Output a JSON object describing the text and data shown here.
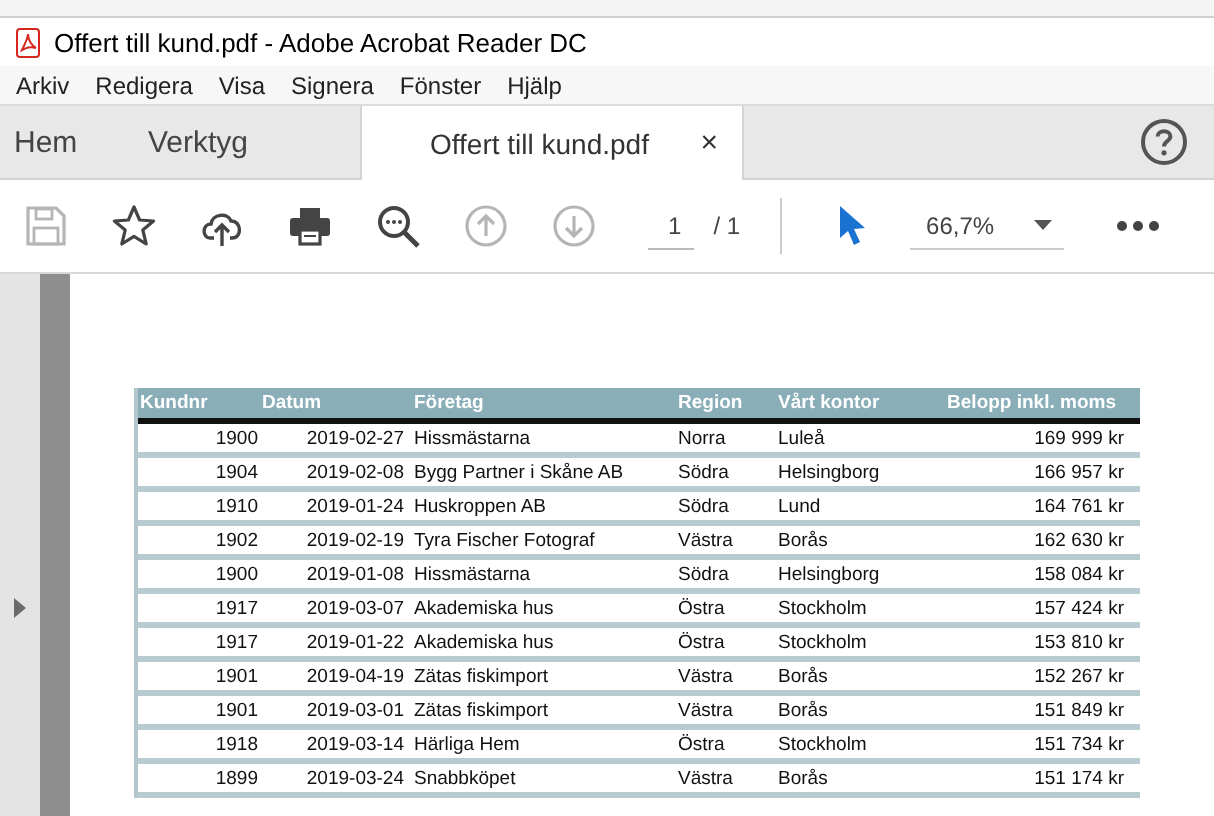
{
  "window": {
    "title": "Offert till kund.pdf - Adobe Acrobat Reader DC"
  },
  "menu": [
    "Arkiv",
    "Redigera",
    "Visa",
    "Signera",
    "Fönster",
    "Hjälp"
  ],
  "tabs": [
    {
      "label": "Hem",
      "selected": false
    },
    {
      "label": "Verktyg",
      "selected": false
    },
    {
      "label": "Offert till kund.pdf",
      "selected": true,
      "close": "×"
    }
  ],
  "toolbar": {
    "tools": [
      {
        "kind": "save",
        "disabled": true
      },
      {
        "kind": "star",
        "disabled": false
      },
      {
        "kind": "upload",
        "disabled": false
      },
      {
        "kind": "print",
        "disabled": false
      },
      {
        "kind": "find",
        "disabled": false
      },
      {
        "kind": "up",
        "disabled": true
      },
      {
        "kind": "down",
        "disabled": true
      }
    ],
    "page": "1",
    "page_total": "/ 1",
    "zoom": "66,7%"
  },
  "table": {
    "columns": [
      "Kundnr",
      "Datum",
      "Företag",
      "Region",
      "Vårt kontor",
      "Belopp inkl. moms"
    ],
    "rows": [
      [
        "1900",
        "2019-02-27",
        "Hissmästarna",
        "Norra",
        "Luleå",
        "169 999 kr"
      ],
      [
        "1904",
        "2019-02-08",
        "Bygg Partner i Skåne AB",
        "Södra",
        "Helsingborg",
        "166 957 kr"
      ],
      [
        "1910",
        "2019-01-24",
        "Huskroppen AB",
        "Södra",
        "Lund",
        "164 761 kr"
      ],
      [
        "1902",
        "2019-02-19",
        "Tyra Fischer Fotograf",
        "Västra",
        "Borås",
        "162 630 kr"
      ],
      [
        "1900",
        "2019-01-08",
        "Hissmästarna",
        "Södra",
        "Helsingborg",
        "158 084 kr"
      ],
      [
        "1917",
        "2019-03-07",
        "Akademiska hus",
        "Östra",
        "Stockholm",
        "157 424 kr"
      ],
      [
        "1917",
        "2019-01-22",
        "Akademiska hus",
        "Östra",
        "Stockholm",
        "153 810 kr"
      ],
      [
        "1901",
        "2019-04-19",
        "Zätas fiskimport",
        "Västra",
        "Borås",
        "152 267 kr"
      ],
      [
        "1901",
        "2019-03-01",
        "Zätas fiskimport",
        "Västra",
        "Borås",
        "151 849 kr"
      ],
      [
        "1918",
        "2019-03-14",
        "Härliga Hem",
        "Östra",
        "Stockholm",
        "151 734 kr"
      ],
      [
        "1899",
        "2019-03-24",
        "Snabbköpet",
        "Västra",
        "Borås",
        "151 174 kr"
      ]
    ]
  }
}
